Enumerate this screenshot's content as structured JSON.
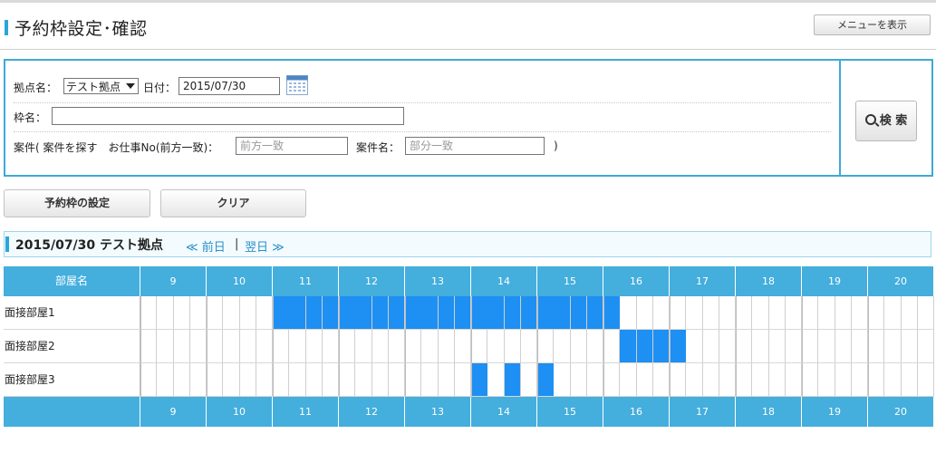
{
  "header": {
    "title": "予約枠設定･確認",
    "menu_button": "メニューを表示"
  },
  "search": {
    "location_label": "拠点名：",
    "location_value": "テスト拠点",
    "date_label": "日付：",
    "date_value": "2015/07/30",
    "frame_label": "枠名：",
    "frame_value": "",
    "case_label": "案件( 案件を探す　お仕事No(前方一致)：",
    "job_no_placeholder": "前方一致",
    "case_name_label": "案件名：",
    "case_name_placeholder": "部分一致",
    "close_paren": ")",
    "search_button": "検 索"
  },
  "actions": {
    "set_frame": "予約枠の設定",
    "clear": "クリア"
  },
  "day": {
    "title": "2015/07/30 テスト拠点",
    "prev": "≪ 前日",
    "separator": "|",
    "next": "翌日 ≫"
  },
  "schedule": {
    "room_header": "部屋名",
    "hours": [
      "9",
      "10",
      "11",
      "12",
      "13",
      "14",
      "15",
      "16",
      "17",
      "18",
      "19",
      "20"
    ],
    "slots_per_hour": 4,
    "rooms": [
      {
        "name": "面接部屋1",
        "booked": [
          8,
          9,
          10,
          11,
          12,
          13,
          14,
          15,
          16,
          17,
          18,
          19,
          20,
          21,
          22,
          23,
          24,
          25,
          26,
          27,
          28
        ]
      },
      {
        "name": "面接部屋2",
        "booked": [
          29,
          30,
          31,
          32
        ]
      },
      {
        "name": "面接部屋3",
        "booked": [
          20,
          22,
          24
        ]
      }
    ]
  },
  "colors": {
    "accent": "#3fa9d6",
    "header_fill": "#44aedd",
    "booked": "#1e8ff3",
    "link": "#2a8fc9"
  }
}
